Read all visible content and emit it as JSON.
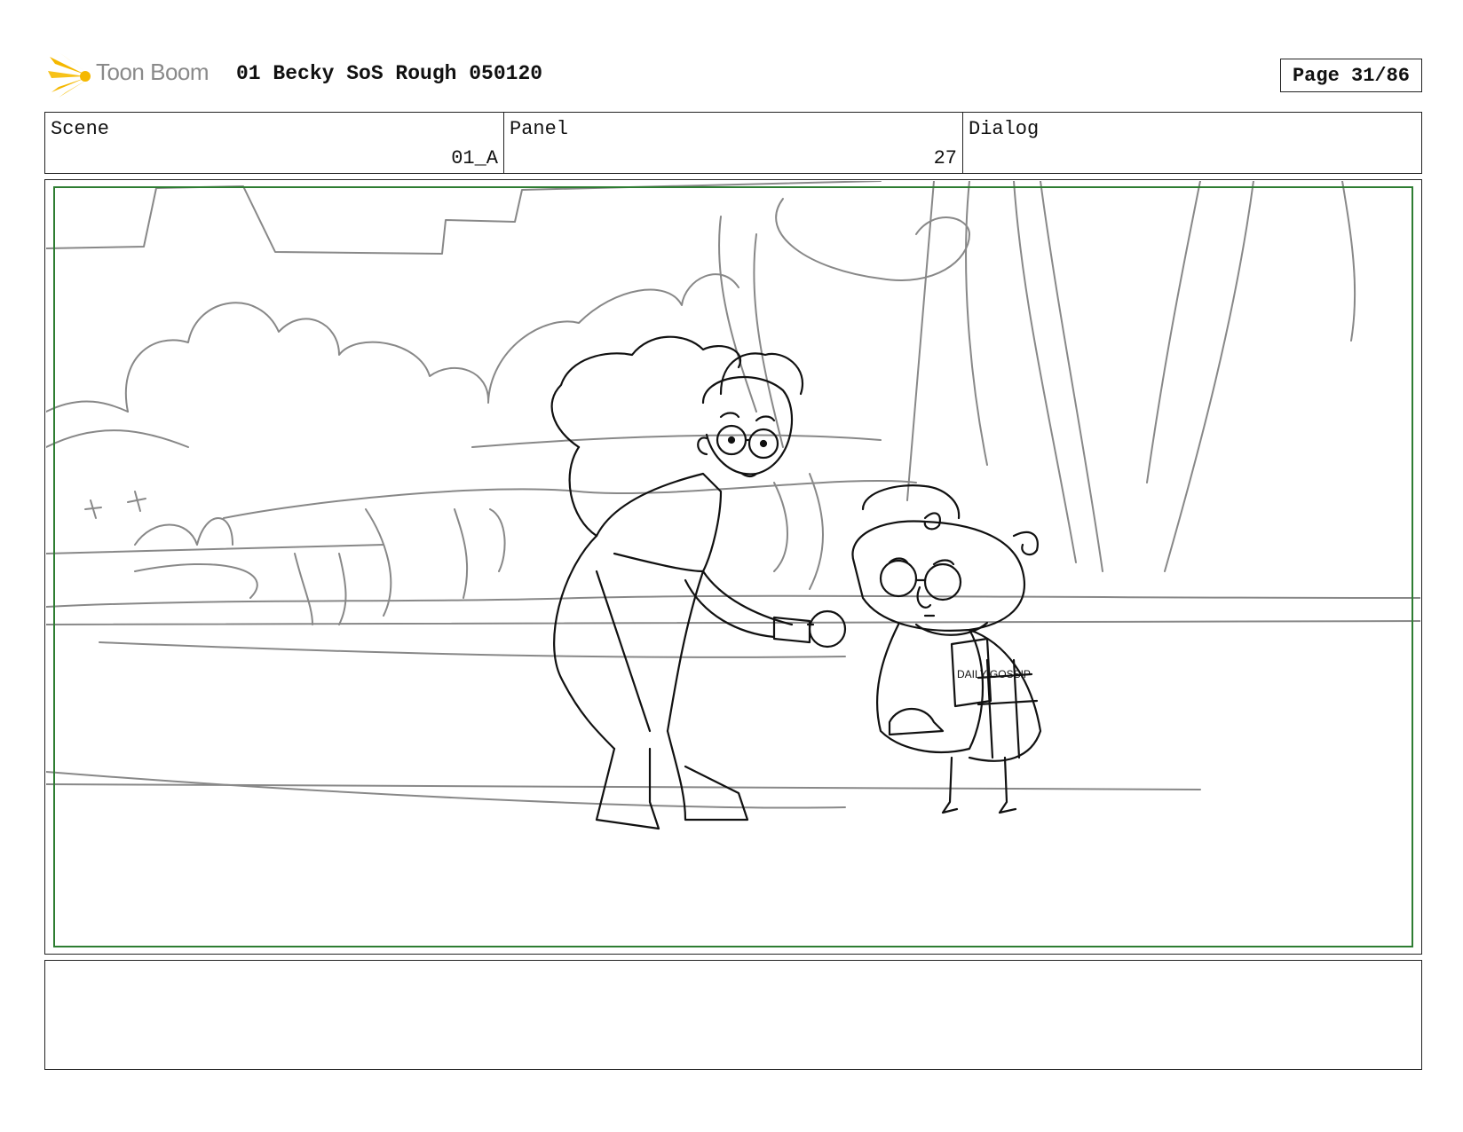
{
  "header": {
    "logo_text": "Toon Boom",
    "title": "01 Becky SoS Rough 050120",
    "page": "Page 31/86"
  },
  "info": {
    "scene_label": "Scene",
    "scene_value": "01_A",
    "panel_label": "Panel",
    "panel_value": "27",
    "dialog_label": "Dialog",
    "dialog_value": ""
  },
  "sketch": {
    "newspaper_text": "DAILY GOSSIP"
  },
  "notes": {
    "text": ""
  },
  "colors": {
    "safe_frame": "#2e7d32",
    "logo_accent": "#f5b800",
    "sketch_line": "#222222",
    "background_line": "#888888"
  }
}
